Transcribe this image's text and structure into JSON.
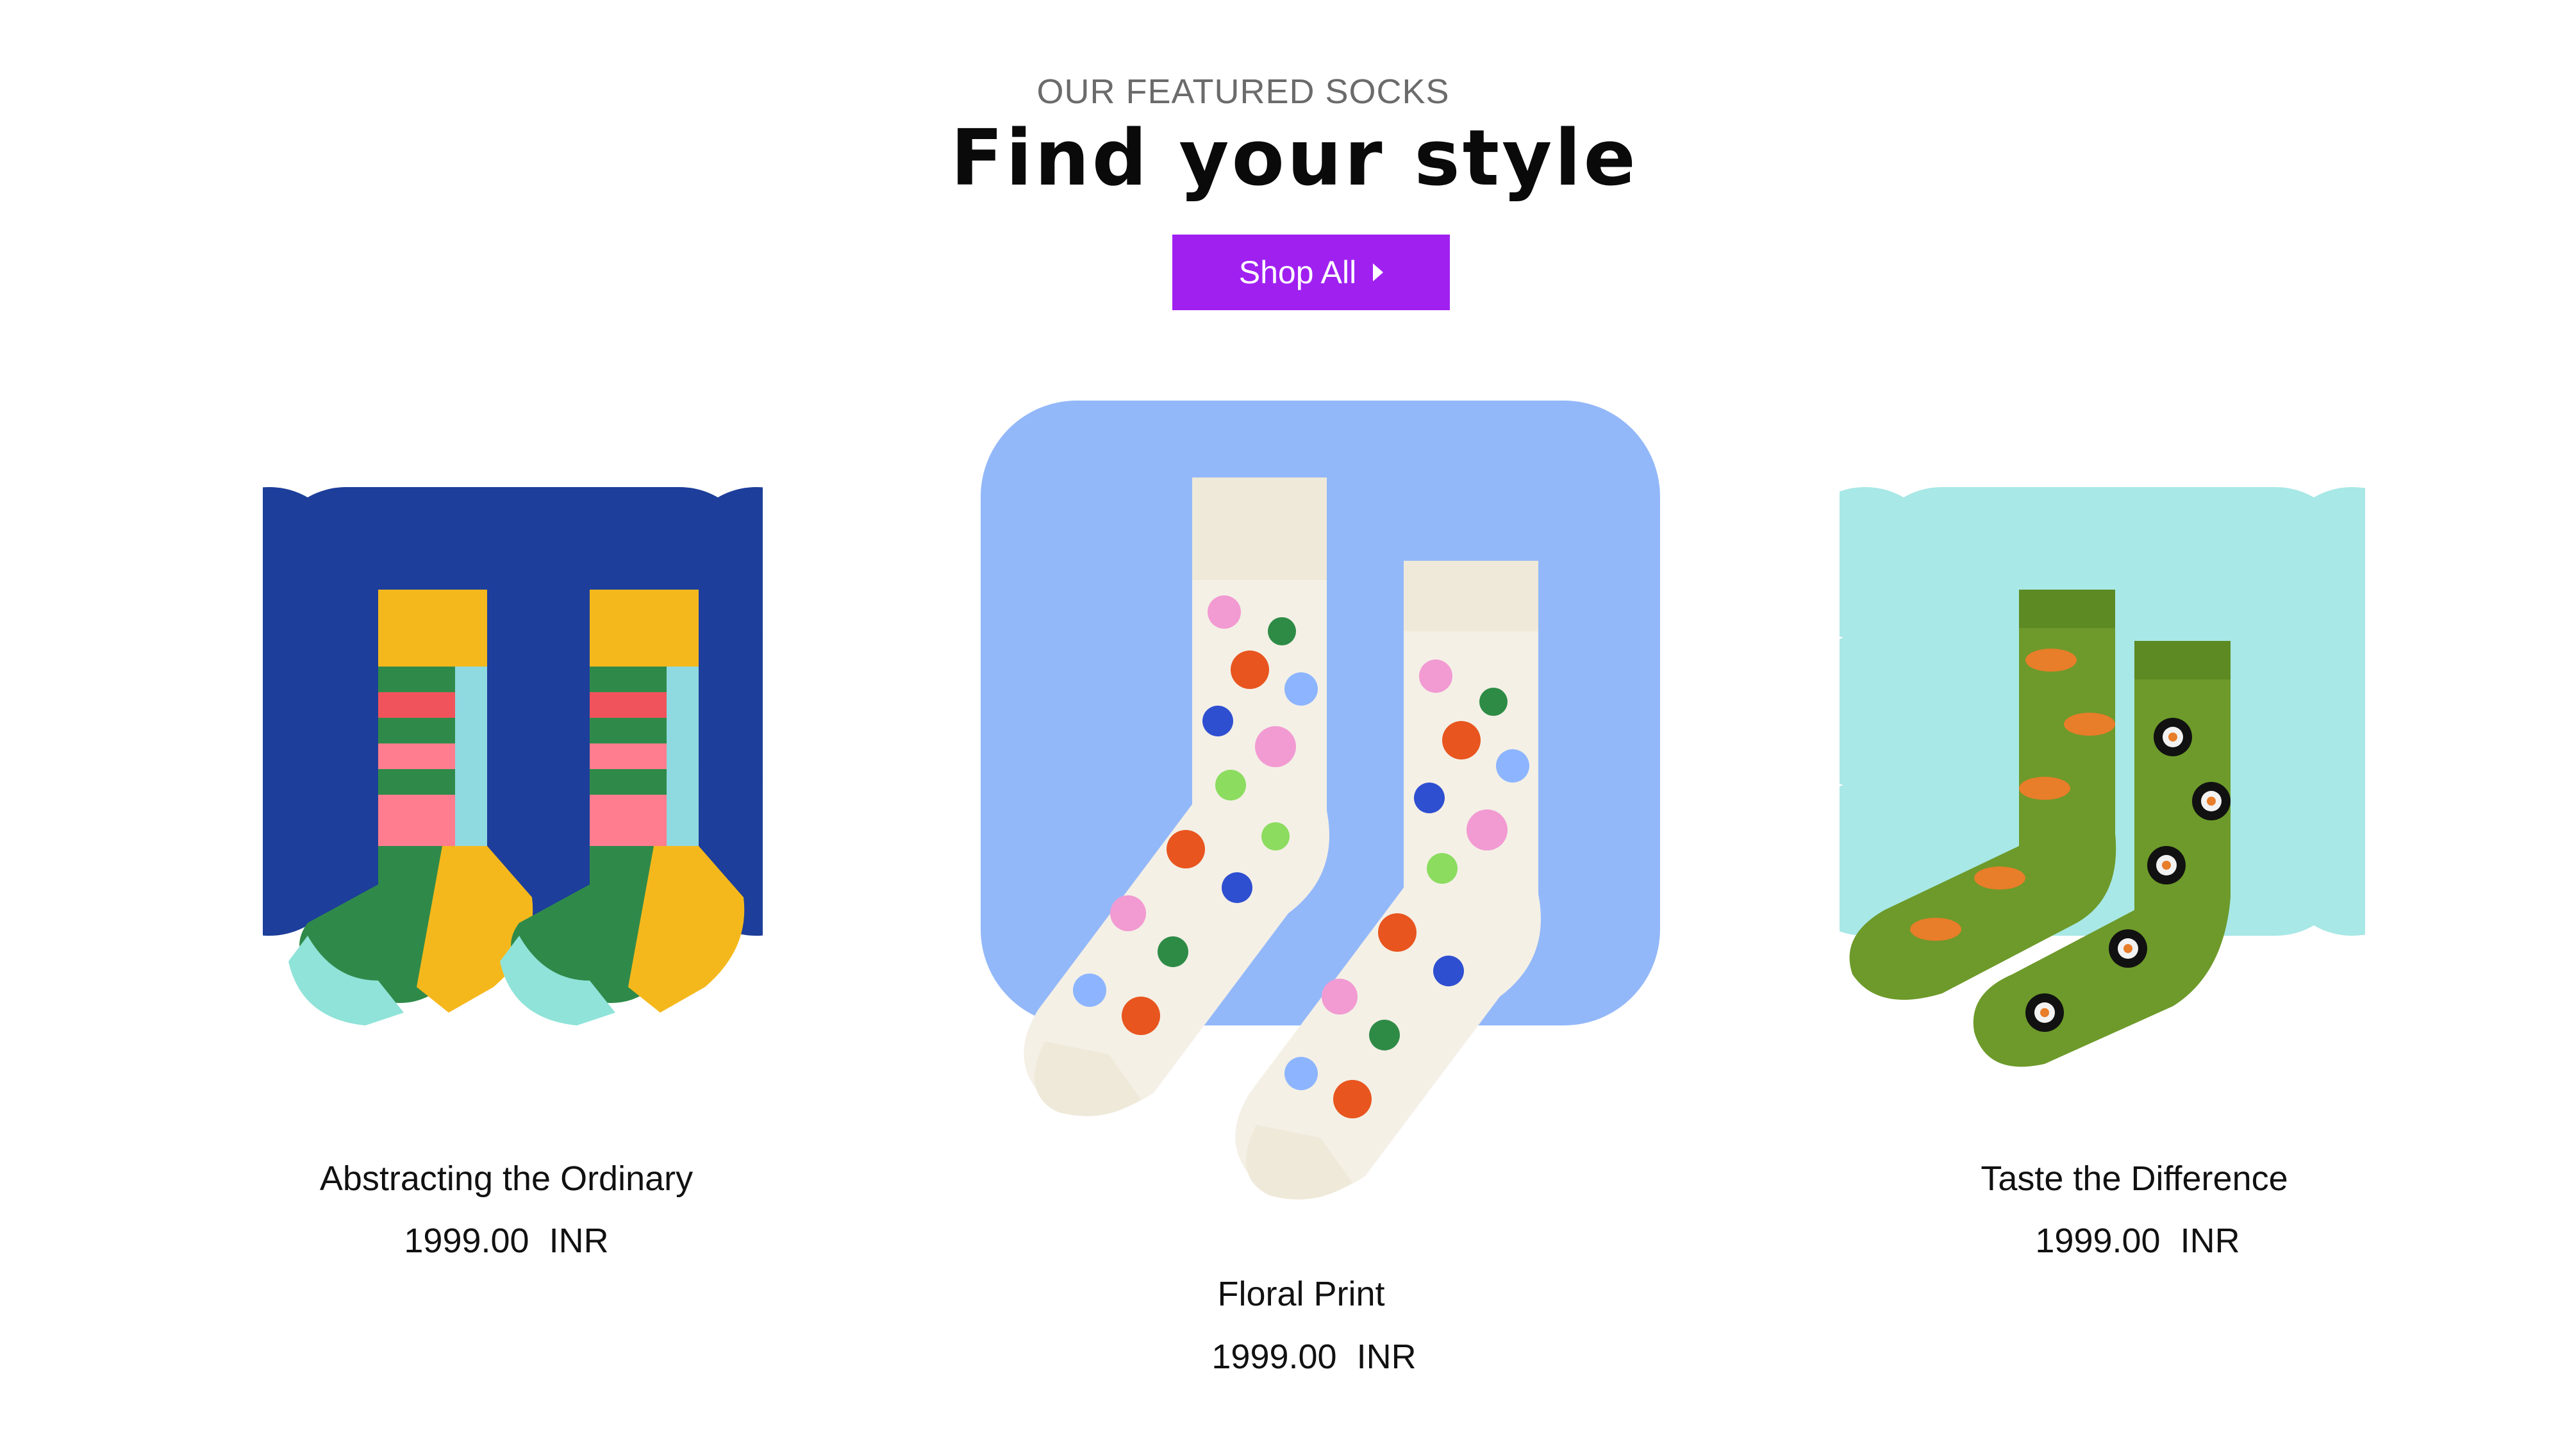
{
  "header": {
    "eyebrow": "OUR FEATURED SOCKS",
    "title": "Find your style",
    "shop_all_label": "Shop All"
  },
  "colors": {
    "accent": "#a020f0",
    "card1_bg": "#1d3e9a",
    "card2_bg": "#93b8f9",
    "card3_bg": "#a8e8e6"
  },
  "products": [
    {
      "name": "Abstracting the Ordinary",
      "price": "1999.00 INR"
    },
    {
      "name": "Floral Print",
      "price": "1999.00 INR"
    },
    {
      "name": "Taste the Difference",
      "price": "1999.00 INR"
    }
  ]
}
